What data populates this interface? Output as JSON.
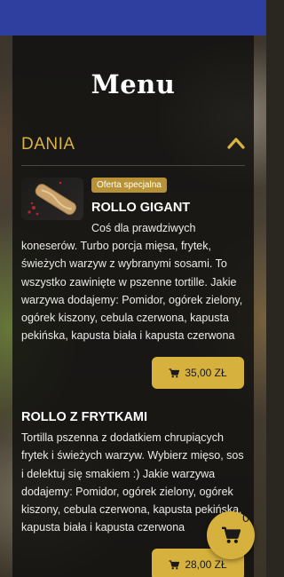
{
  "header": {
    "title": "Menu"
  },
  "section": {
    "title": "DANIA"
  },
  "items": [
    {
      "badge": "Oferta specjalna",
      "name": "ROLLO GIGANT",
      "desc_first": "Coś dla prawdziwych",
      "desc_rest": "koneserów. Turbo porcja mięsa, frytek, świeżych warzyw z wybranymi sosami. To wszystko zawinięte w pszenne tortille. Jakie warzywa dodajemy: Pomidor, ogórek zielony, ogórek kiszony, cebula czerwona, kapusta pekińska, kapusta biała i kapusta czerwona",
      "price": "35,00 ZŁ"
    },
    {
      "name": "ROLLO Z FRYTKAMI",
      "desc": "Tortilla pszenna z dodatkiem chrupiących frytek i świeżych warzyw. Wybierz mięso, sos i delektuj się smakiem :) Jakie warzywa dodajemy: Pomidor, ogórek zielony, ogórek kiszony, cebula czerwona, kapusta pekińska, kapusta biała i kapusta czerwona",
      "price": "28,00 ZŁ"
    }
  ],
  "cart": {
    "count": "0"
  },
  "colors": {
    "accent": "#d6b13e",
    "section_title": "#d8b244",
    "status_bar": "#2f3f9f",
    "badge": "#b79236"
  },
  "icons": {
    "section_toggle": "chevron-up-icon",
    "price_cart": "cart-icon",
    "fab": "cart-icon"
  }
}
